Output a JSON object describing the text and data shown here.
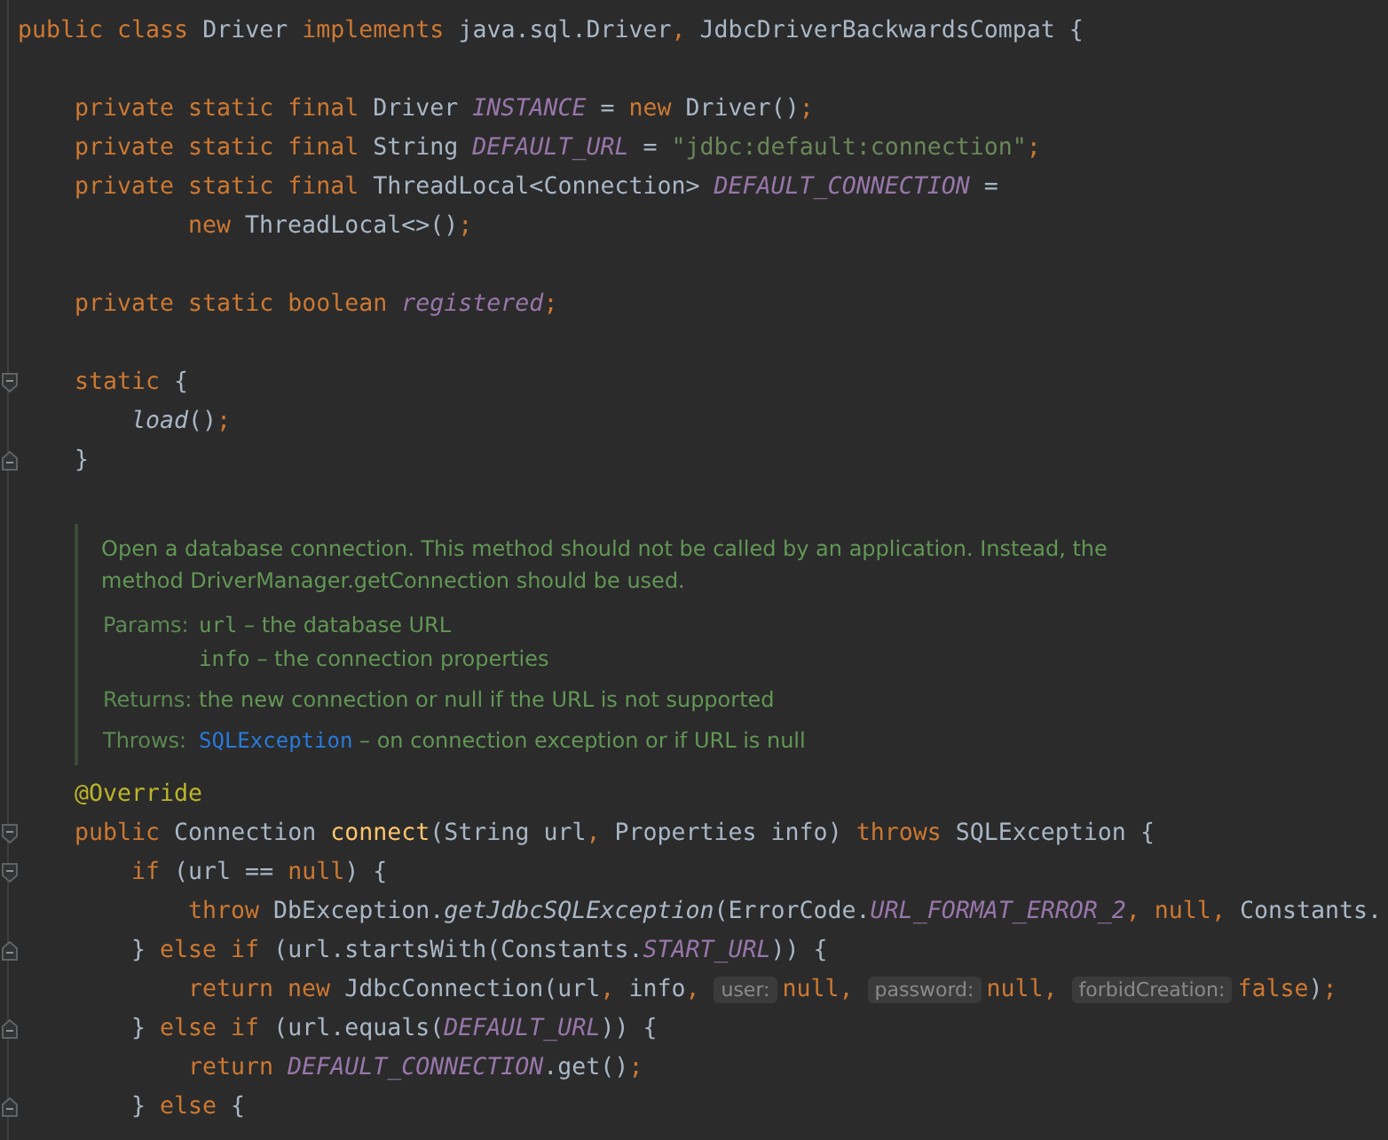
{
  "editor": {
    "lines": [
      {
        "kind": "code",
        "tokens": [
          {
            "kind": "kw",
            "text": "public class "
          },
          {
            "kind": "plain",
            "text": "Driver "
          },
          {
            "kind": "kw",
            "text": "implements "
          },
          {
            "kind": "plain",
            "text": "java.sql.Driver"
          },
          {
            "kind": "kw",
            "text": ", "
          },
          {
            "kind": "plain",
            "text": "JdbcDriverBackwardsCompat {"
          }
        ],
        "children": [
          {
            "kind": "blank"
          },
          {
            "kind": "code",
            "tokens": [
              {
                "kind": "kw",
                "text": "private static final "
              },
              {
                "kind": "plain",
                "text": "Driver "
              },
              {
                "kind": "field",
                "text": "INSTANCE"
              },
              {
                "kind": "plain",
                "text": " = "
              },
              {
                "kind": "kw",
                "text": "new "
              },
              {
                "kind": "plain",
                "text": "Driver()"
              },
              {
                "kind": "kw",
                "text": ";"
              }
            ]
          },
          {
            "kind": "code",
            "tokens": [
              {
                "kind": "kw",
                "text": "private static final "
              },
              {
                "kind": "plain",
                "text": "String "
              },
              {
                "kind": "field",
                "text": "DEFAULT_URL"
              },
              {
                "kind": "plain",
                "text": " = "
              },
              {
                "kind": "string",
                "text": "\"jdbc:default:connection\""
              },
              {
                "kind": "kw",
                "text": ";"
              }
            ]
          },
          {
            "kind": "code",
            "tokens": [
              {
                "kind": "kw",
                "text": "private static final "
              },
              {
                "kind": "plain",
                "text": "ThreadLocal<Connection> "
              },
              {
                "kind": "field",
                "text": "DEFAULT_CONNECTION"
              },
              {
                "kind": "plain",
                "text": " ="
              }
            ],
            "children": [
              {
                "kind": "continuation",
                "tokens": [
                  {
                    "kind": "kw",
                    "text": "new "
                  },
                  {
                    "kind": "plain",
                    "text": "ThreadLocal<>()"
                  },
                  {
                    "kind": "kw",
                    "text": ";"
                  }
                ]
              }
            ]
          },
          {
            "kind": "blank"
          },
          {
            "kind": "code",
            "tokens": [
              {
                "kind": "kw",
                "text": "private static boolean "
              },
              {
                "kind": "field",
                "text": "registered"
              },
              {
                "kind": "kw",
                "text": ";"
              }
            ]
          },
          {
            "kind": "blank"
          },
          {
            "kind": "code",
            "fold_start": true,
            "tokens": [
              {
                "kind": "kw",
                "text": "static "
              },
              {
                "kind": "plain",
                "text": "{"
              }
            ],
            "children": [
              {
                "kind": "code",
                "tokens": [
                  {
                    "kind": "static",
                    "text": "load"
                  },
                  {
                    "kind": "plain",
                    "text": "()"
                  },
                  {
                    "kind": "kw",
                    "text": ";"
                  }
                ]
              }
            ]
          },
          {
            "kind": "code",
            "fold_end": true,
            "tokens": [
              {
                "kind": "plain",
                "text": "}"
              }
            ]
          },
          {
            "kind": "doc",
            "description": "Open a database connection. This method should not be called by an application. Instead, the method DriverManager.getConnection should be used.",
            "params_label": "Params:",
            "params": [
              {
                "name": "url",
                "text": " – the database URL"
              },
              {
                "name": "info",
                "text": " – the connection properties"
              }
            ],
            "returns_label": "Returns:",
            "returns": "the new connection or null if the URL is not supported",
            "throws_label": "Throws:",
            "throws_link": "SQLException",
            "throws_text": " – on connection exception or if URL is null"
          },
          {
            "kind": "code",
            "tokens": [
              {
                "kind": "annotation",
                "text": "@Override"
              }
            ]
          },
          {
            "kind": "code",
            "fold_start": true,
            "tokens": [
              {
                "kind": "kw",
                "text": "public "
              },
              {
                "kind": "plain",
                "text": "Connection "
              },
              {
                "kind": "method",
                "text": "connect"
              },
              {
                "kind": "plain",
                "text": "(String url"
              },
              {
                "kind": "kw",
                "text": ", "
              },
              {
                "kind": "plain",
                "text": "Properties info) "
              },
              {
                "kind": "kw",
                "text": "throws "
              },
              {
                "kind": "plain",
                "text": "SQLException {"
              }
            ],
            "children": [
              {
                "kind": "code",
                "fold_start": true,
                "tokens": [
                  {
                    "kind": "kw",
                    "text": "if "
                  },
                  {
                    "kind": "plain",
                    "text": "(url == "
                  },
                  {
                    "kind": "kw",
                    "text": "null"
                  },
                  {
                    "kind": "plain",
                    "text": ") {"
                  }
                ],
                "children": [
                  {
                    "kind": "code",
                    "tokens": [
                      {
                        "kind": "kw",
                        "text": "throw "
                      },
                      {
                        "kind": "plain",
                        "text": "DbException."
                      },
                      {
                        "kind": "static",
                        "text": "getJdbcSQLException"
                      },
                      {
                        "kind": "plain",
                        "text": "(ErrorCode."
                      },
                      {
                        "kind": "field",
                        "text": "URL_FORMAT_ERROR_2"
                      },
                      {
                        "kind": "kw",
                        "text": ", null, "
                      },
                      {
                        "kind": "plain",
                        "text": "Constants."
                      }
                    ]
                  }
                ]
              },
              {
                "kind": "code",
                "fold_end": true,
                "tokens": [
                  {
                    "kind": "plain",
                    "text": "} "
                  },
                  {
                    "kind": "kw",
                    "text": "else if "
                  },
                  {
                    "kind": "plain",
                    "text": "(url.startsWith(Constants."
                  },
                  {
                    "kind": "field",
                    "text": "START_URL"
                  },
                  {
                    "kind": "plain",
                    "text": ")) {"
                  }
                ],
                "children": [
                  {
                    "kind": "code",
                    "tokens": [
                      {
                        "kind": "kw",
                        "text": "return new "
                      },
                      {
                        "kind": "plain",
                        "text": "JdbcConnection(url"
                      },
                      {
                        "kind": "kw",
                        "text": ", "
                      },
                      {
                        "kind": "plain",
                        "text": "info"
                      },
                      {
                        "kind": "kw",
                        "text": ", "
                      },
                      {
                        "kind": "hint",
                        "text": "user:"
                      },
                      {
                        "kind": "kw",
                        "text": "null, "
                      },
                      {
                        "kind": "hint",
                        "text": "password:"
                      },
                      {
                        "kind": "kw",
                        "text": "null, "
                      },
                      {
                        "kind": "hint",
                        "text": "forbidCreation:"
                      },
                      {
                        "kind": "kw",
                        "text": "false"
                      },
                      {
                        "kind": "plain",
                        "text": ")"
                      },
                      {
                        "kind": "kw",
                        "text": ";"
                      }
                    ]
                  }
                ]
              },
              {
                "kind": "code",
                "fold_end": true,
                "tokens": [
                  {
                    "kind": "plain",
                    "text": "} "
                  },
                  {
                    "kind": "kw",
                    "text": "else if "
                  },
                  {
                    "kind": "plain",
                    "text": "(url.equals("
                  },
                  {
                    "kind": "field",
                    "text": "DEFAULT_URL"
                  },
                  {
                    "kind": "plain",
                    "text": ")) {"
                  }
                ],
                "children": [
                  {
                    "kind": "code",
                    "tokens": [
                      {
                        "kind": "kw",
                        "text": "return "
                      },
                      {
                        "kind": "field",
                        "text": "DEFAULT_CONNECTION"
                      },
                      {
                        "kind": "plain",
                        "text": ".get()"
                      },
                      {
                        "kind": "kw",
                        "text": ";"
                      }
                    ]
                  }
                ]
              },
              {
                "kind": "code",
                "fold_end": true,
                "tokens": [
                  {
                    "kind": "plain",
                    "text": "} "
                  },
                  {
                    "kind": "kw",
                    "text": "else "
                  },
                  {
                    "kind": "plain",
                    "text": "{"
                  }
                ]
              }
            ]
          }
        ]
      }
    ]
  }
}
